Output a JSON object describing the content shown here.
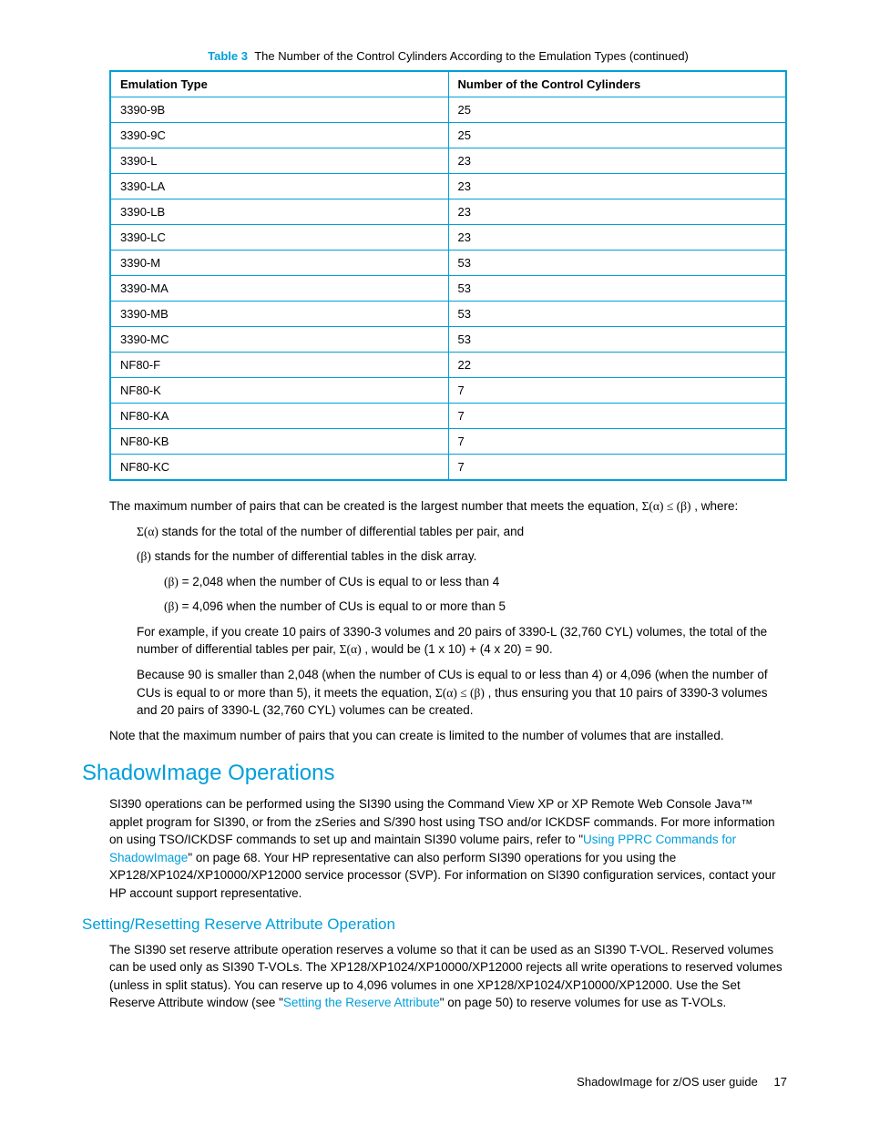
{
  "table": {
    "label": "Table 3",
    "caption": "The Number of the Control Cylinders According to the Emulation Types (continued)",
    "headers": [
      "Emulation Type",
      "Number of the Control Cylinders"
    ],
    "rows": [
      [
        "3390-9B",
        "25"
      ],
      [
        "3390-9C",
        "25"
      ],
      [
        "3390-L",
        "23"
      ],
      [
        "3390-LA",
        "23"
      ],
      [
        "3390-LB",
        "23"
      ],
      [
        "3390-LC",
        "23"
      ],
      [
        "3390-M",
        "53"
      ],
      [
        "3390-MA",
        "53"
      ],
      [
        "3390-MB",
        "53"
      ],
      [
        "3390-MC",
        "53"
      ],
      [
        "NF80-F",
        "22"
      ],
      [
        "NF80-K",
        "7"
      ],
      [
        "NF80-KA",
        "7"
      ],
      [
        "NF80-KB",
        "7"
      ],
      [
        "NF80-KC",
        "7"
      ]
    ]
  },
  "para": {
    "intro_a": "The maximum number of pairs that can be created is the largest number that meets the equation, ",
    "intro_eq": "Σ(α) ≤ (β)",
    "intro_b": " , where:",
    "sigma_a": "Σ(α)",
    "sigma_a_text": " stands for the total of the number of differential tables per pair, and",
    "beta": "(β)",
    "beta_text": " stands for the number of differential tables in the disk array.",
    "beta_2048": " = 2,048 when the number of CUs is equal to or less than 4",
    "beta_4096": " = 4,096 when the number of CUs is equal to or more than 5",
    "example1_a": "For example, if you create 10 pairs of 3390-3 volumes and 20 pairs of 3390-L (32,760 CYL) volumes, the total of the number of differential tables per pair, ",
    "example1_sym": "Σ(α)",
    "example1_b": " , would be (1 x 10) + (4 x 20) = 90.",
    "example2_a": "Because 90 is smaller than 2,048 (when the number of CUs is equal to or less than 4) or 4,096 (when the number of CUs is equal to or more than 5), it meets the equation, ",
    "example2_sym": "Σ(α) ≤ (β)",
    "example2_b": " , thus ensuring you that 10 pairs of 3390-3 volumes and 20 pairs of 3390-L (32,760 CYL) volumes can be created.",
    "note": "Note that the maximum number of pairs that you can create is limited to the number of volumes that are installed."
  },
  "shadow": {
    "heading": "ShadowImage Operations",
    "p1_a": "SI390 operations can be performed using the SI390 using the Command View XP or XP Remote Web Console Java™ applet program for SI390, or from the zSeries and S/390 host using TSO and/or ICKDSF commands. For more information on using TSO/ICKDSF commands to set up and maintain SI390 volume pairs, refer to \"",
    "p1_link": "Using PPRC Commands for ShadowImage",
    "p1_b": "\" on page 68. Your HP representative can also perform SI390 operations for you using the XP128/XP1024/XP10000/XP12000 service processor (SVP). For information on SI390 configuration services, contact your HP account support representative."
  },
  "setting": {
    "heading": "Setting/Resetting Reserve Attribute Operation",
    "p1_a": "The SI390 set reserve attribute operation reserves a volume so that it can be used as an SI390 T-VOL. Reserved volumes can be used only as SI390 T-VOLs. The XP128/XP1024/XP10000/XP12000 rejects all write operations to reserved volumes (unless in split status). You can reserve up to 4,096 volumes in one XP128/XP1024/XP10000/XP12000. Use the Set Reserve Attribute window (see \"",
    "p1_link": "Setting the Reserve Attribute",
    "p1_b": "\" on page 50) to reserve volumes for use as T-VOLs."
  },
  "footer": {
    "title": "ShadowImage for z/OS user guide",
    "page": "17"
  }
}
